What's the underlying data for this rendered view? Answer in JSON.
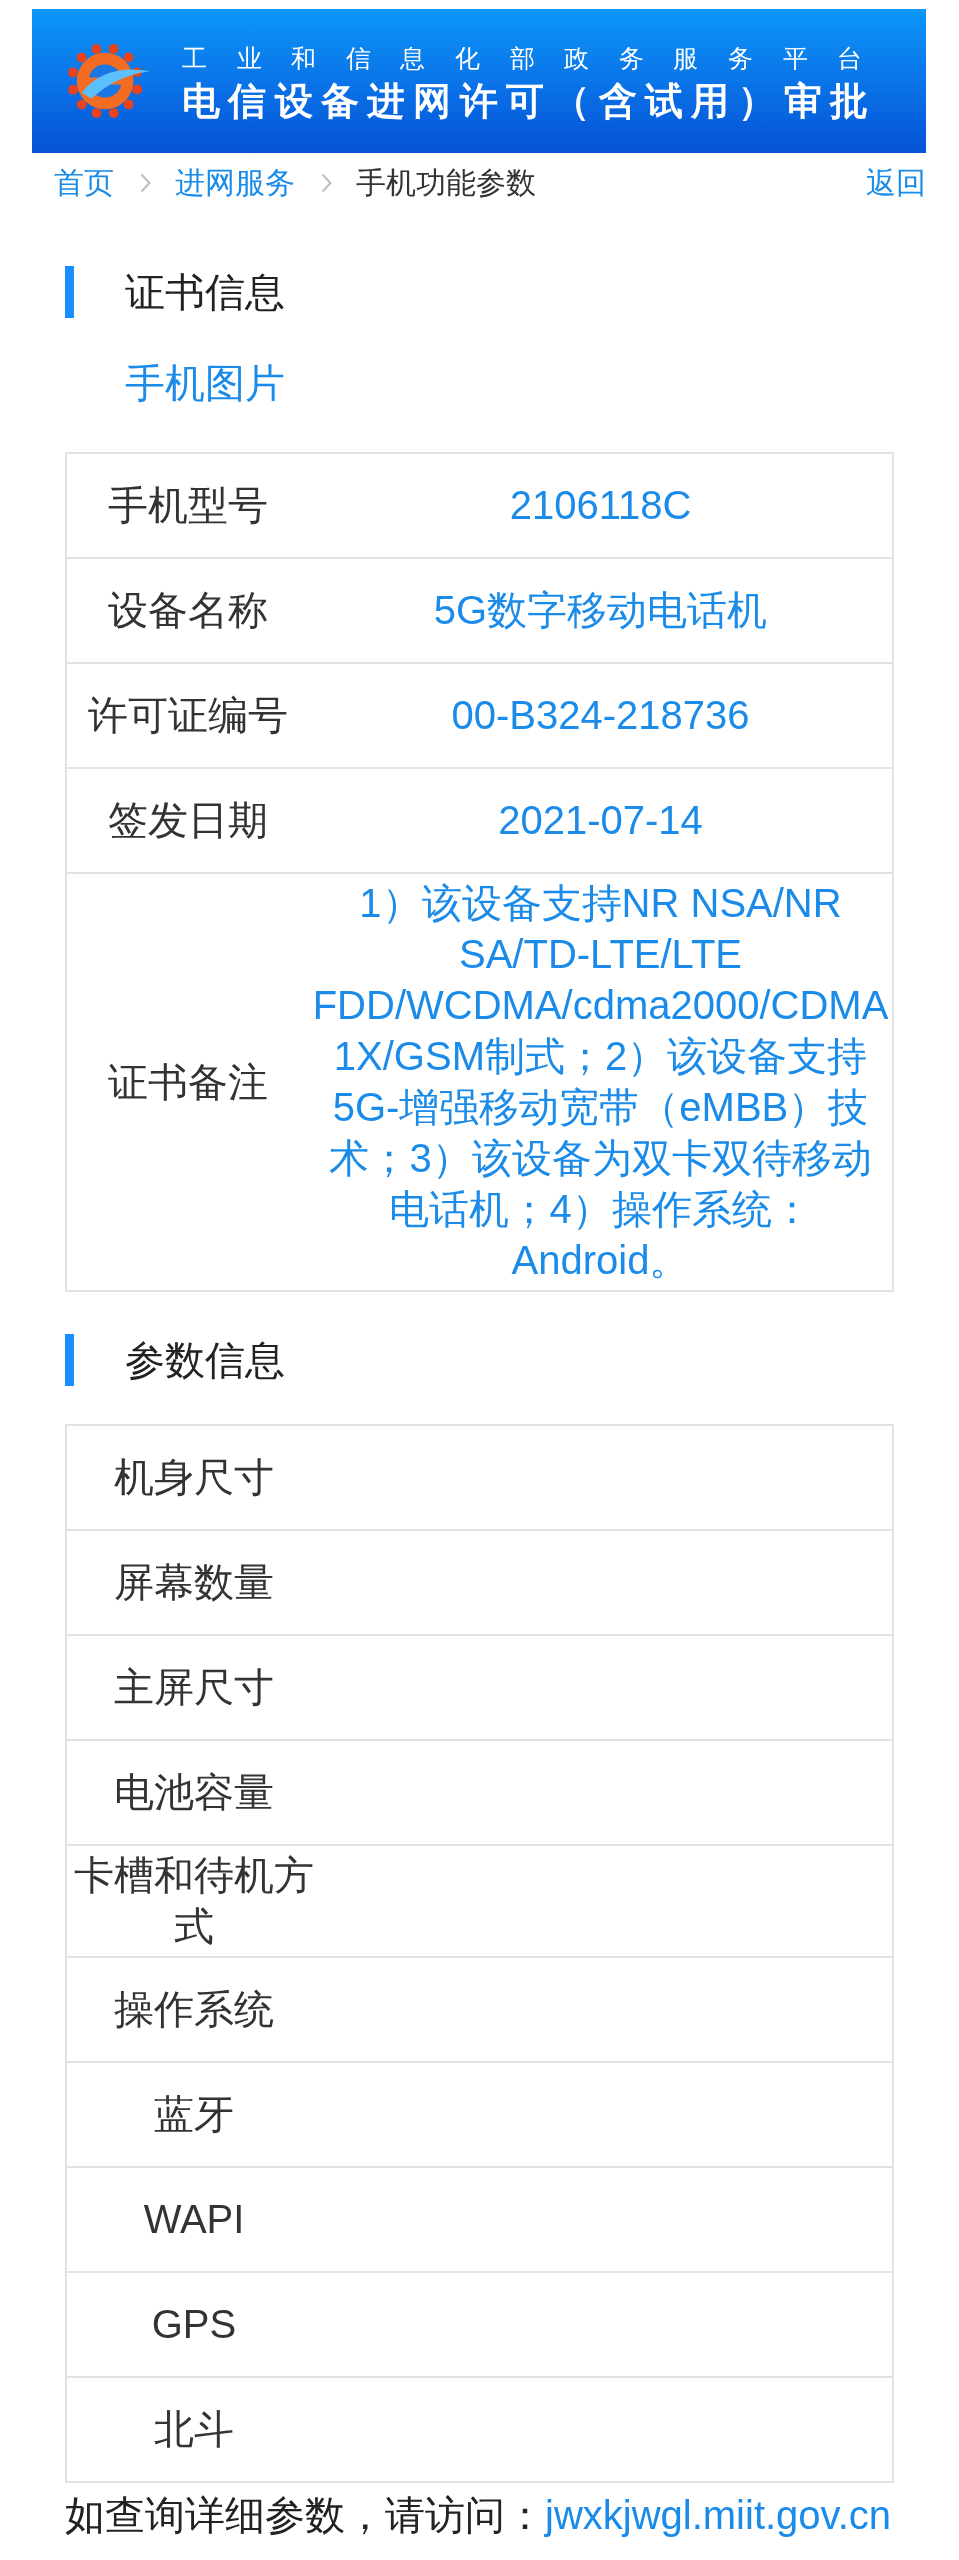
{
  "banner": {
    "subtitle": "工业和信息化部政务服务平台",
    "title": "电信设备进网许可（含试用）审批"
  },
  "breadcrumb": [
    {
      "label": "首页",
      "kind": "link"
    },
    {
      "label": "进网服务",
      "kind": "link"
    },
    {
      "label": "手机功能参数",
      "kind": "current"
    }
  ],
  "back_link": "返回",
  "certificate_info": {
    "title": "证书信息",
    "photo_link": "手机图片",
    "rows": [
      {
        "label": "手机型号",
        "value": "2106118C"
      },
      {
        "label": "设备名称",
        "value": "5G数字移动电话机"
      },
      {
        "label": "许可证编号",
        "value": "00-B324-218736"
      },
      {
        "label": "签发日期",
        "value": "2021-07-14"
      },
      {
        "label": "证书备注",
        "value": "1）该设备支持NR NSA/NR SA/TD-LTE/LTE FDD/WCDMA/cdma2000/CDMA 1X/GSM制式；2）该设备支持5G-增强移动宽带（eMBB）技术；3）该设备为双卡双待移动电话机；4）操作系统：Android。"
      }
    ]
  },
  "parameter_info": {
    "title": "参数信息",
    "rows": [
      {
        "label": "机身尺寸"
      },
      {
        "label": "屏幕数量"
      },
      {
        "label": "主屏尺寸"
      },
      {
        "label": "电池容量"
      },
      {
        "label": "卡槽和待机方式"
      },
      {
        "label": "操作系统"
      },
      {
        "label": "蓝牙"
      },
      {
        "label": "WAPI"
      },
      {
        "label": "GPS"
      },
      {
        "label": "北斗"
      }
    ]
  },
  "footer": {
    "text": "如查询详细参数，请访问：",
    "link": "jwxkjwgl.miit.gov.cn"
  }
}
